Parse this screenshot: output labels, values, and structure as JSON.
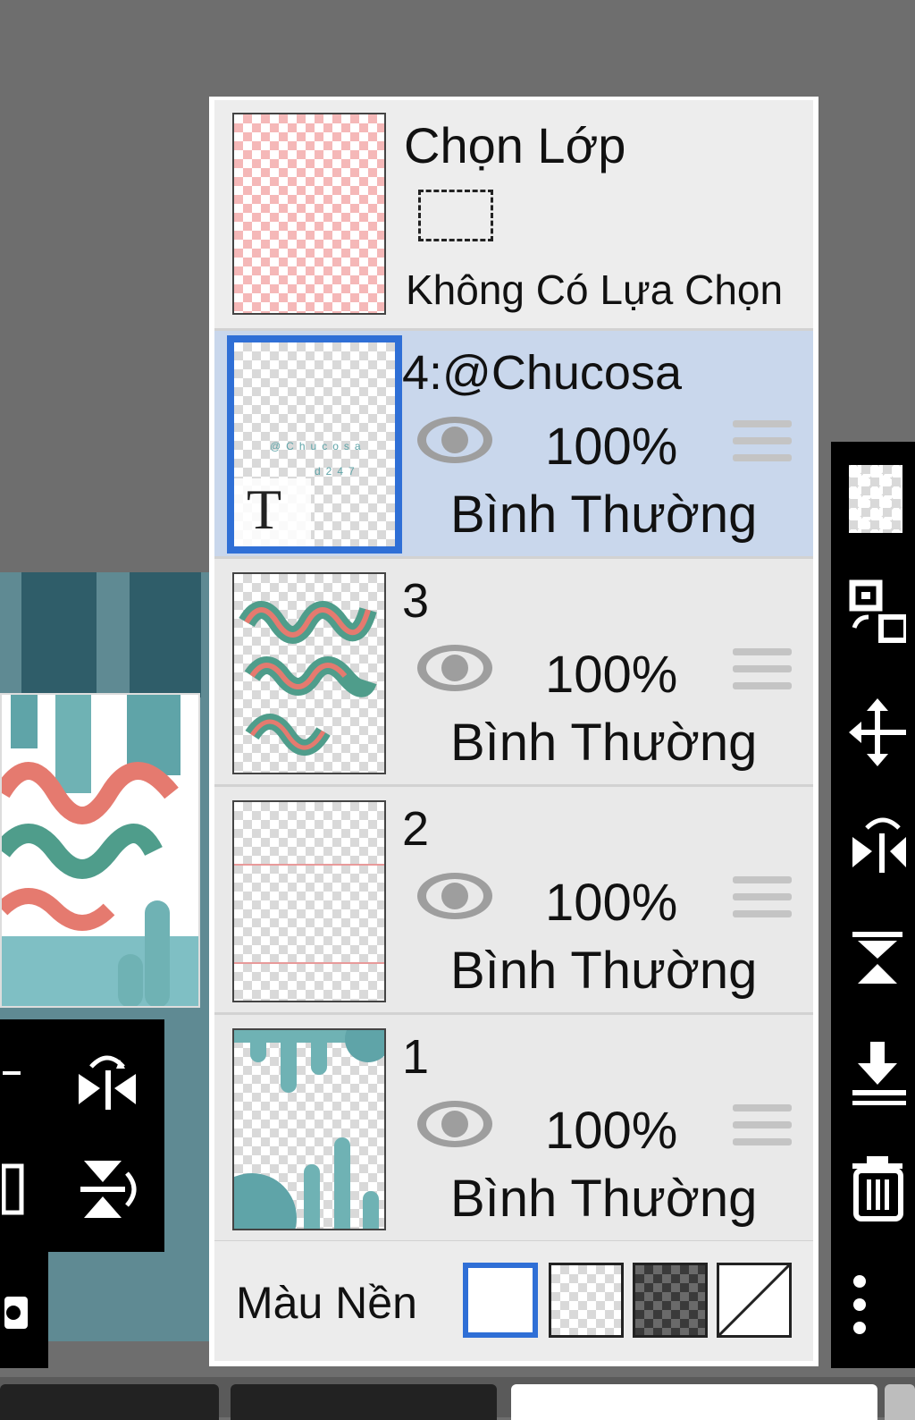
{
  "selection_layer": {
    "title": "Chọn Lớp",
    "subtitle": "Không Có Lựa Chọn"
  },
  "layers": [
    {
      "name": "4:@Chucosa",
      "opacity": "100%",
      "blend": "Bình Thường",
      "selected": true,
      "type": "text",
      "thumb_glyph": "T"
    },
    {
      "name": "3",
      "opacity": "100%",
      "blend": "Bình Thường",
      "selected": false,
      "type": "image"
    },
    {
      "name": "2",
      "opacity": "100%",
      "blend": "Bình Thường",
      "selected": false,
      "type": "image"
    },
    {
      "name": "1",
      "opacity": "100%",
      "blend": "Bình Thường",
      "selected": false,
      "type": "image"
    }
  ],
  "background": {
    "label": "Màu Nền",
    "options": [
      "white",
      "transparent-light",
      "transparent-dark",
      "none"
    ],
    "selected": "white"
  },
  "right_toolbar": {
    "icons": [
      "transparency-icon",
      "transform-icon",
      "move-icon",
      "flip-horizontal-icon",
      "flip-vertical-icon",
      "merge-down-icon",
      "trash-icon",
      "more-vertical-icon"
    ]
  },
  "left_toolbox": {
    "icons": [
      "flip-horizontal-icon",
      "copy-icon",
      "flip-vertical-icon",
      "camera-icon"
    ]
  },
  "colors": {
    "selected_row": "#c9d7ec",
    "accent_blue": "#2f6fd6",
    "panel_bg": "#e8e8e8",
    "app_bg": "#6e6e6e"
  }
}
